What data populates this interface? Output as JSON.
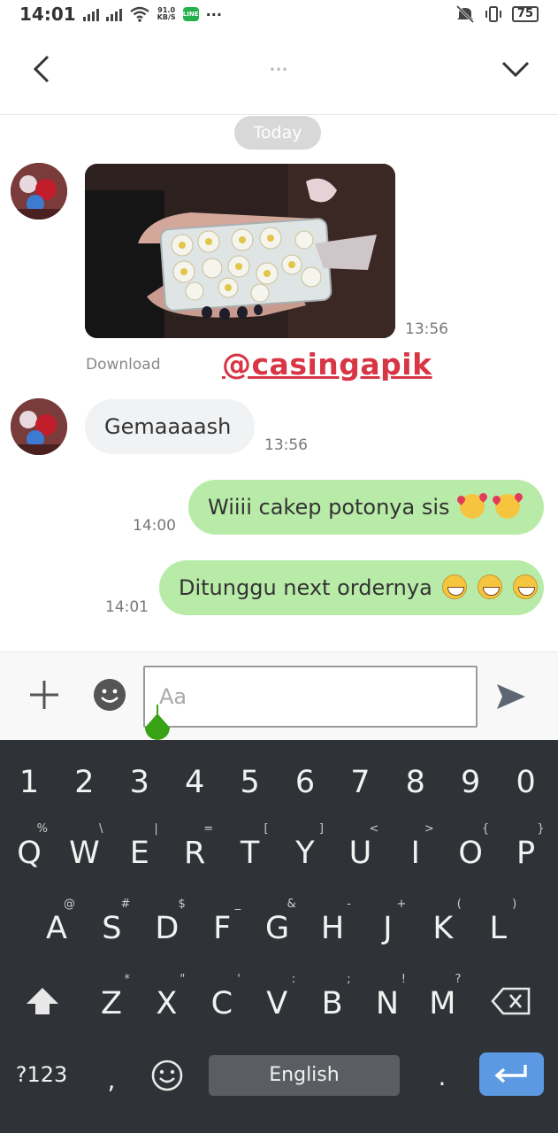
{
  "status_bar": {
    "time": "14:01",
    "net_speed_value": "91.0",
    "net_speed_unit": "KB/S",
    "battery": "75",
    "line_app_icon": "LINE"
  },
  "header": {
    "title": "•••"
  },
  "chat": {
    "date_label": "Today",
    "messages": [
      {
        "type": "image",
        "direction": "incoming",
        "time": "13:56",
        "action_label": "Download"
      },
      {
        "type": "text",
        "direction": "incoming",
        "text": "Gemaaaash",
        "time": "13:56"
      },
      {
        "type": "text",
        "direction": "outgoing",
        "text": "Wiiii cakep potonya sis",
        "emojis": [
          "smiling-face-with-hearts",
          "smiling-face-with-hearts"
        ],
        "time": "14:00"
      },
      {
        "type": "text",
        "direction": "outgoing",
        "text": "Ditunggu next ordernya",
        "emojis": [
          "grinning-face",
          "grinning-face",
          "grinning-face"
        ],
        "time": "14:01"
      }
    ],
    "watermark": "@casingapik"
  },
  "composer": {
    "placeholder": "Aa"
  },
  "keyboard": {
    "number_row": [
      "1",
      "2",
      "3",
      "4",
      "5",
      "6",
      "7",
      "8",
      "9",
      "0"
    ],
    "row1": [
      {
        "k": "Q",
        "alt": "%"
      },
      {
        "k": "W",
        "alt": "\\"
      },
      {
        "k": "E",
        "alt": "|"
      },
      {
        "k": "R",
        "alt": "="
      },
      {
        "k": "T",
        "alt": "["
      },
      {
        "k": "Y",
        "alt": "]"
      },
      {
        "k": "U",
        "alt": "<"
      },
      {
        "k": "I",
        "alt": ">"
      },
      {
        "k": "O",
        "alt": "{"
      },
      {
        "k": "P",
        "alt": "}"
      }
    ],
    "row2": [
      {
        "k": "A",
        "alt": "@"
      },
      {
        "k": "S",
        "alt": "#"
      },
      {
        "k": "D",
        "alt": "$"
      },
      {
        "k": "F",
        "alt": "_"
      },
      {
        "k": "G",
        "alt": "&"
      },
      {
        "k": "H",
        "alt": "-"
      },
      {
        "k": "J",
        "alt": "+"
      },
      {
        "k": "K",
        "alt": "("
      },
      {
        "k": "L",
        "alt": ")"
      }
    ],
    "row3": [
      {
        "k": "Z",
        "alt": "*"
      },
      {
        "k": "X",
        "alt": "\""
      },
      {
        "k": "C",
        "alt": "'"
      },
      {
        "k": "V",
        "alt": ":"
      },
      {
        "k": "B",
        "alt": ";"
      },
      {
        "k": "N",
        "alt": "!"
      },
      {
        "k": "M",
        "alt": "?"
      }
    ],
    "symbols_label": "?123",
    "comma": ",",
    "period": ".",
    "space_label": "English"
  },
  "colors": {
    "outgoing_bubble": "#b9eba8",
    "incoming_bubble": "#f1f2f4",
    "keyboard_bg": "#2f3337",
    "enter_key": "#5b9ae3",
    "watermark": "#d83545"
  }
}
